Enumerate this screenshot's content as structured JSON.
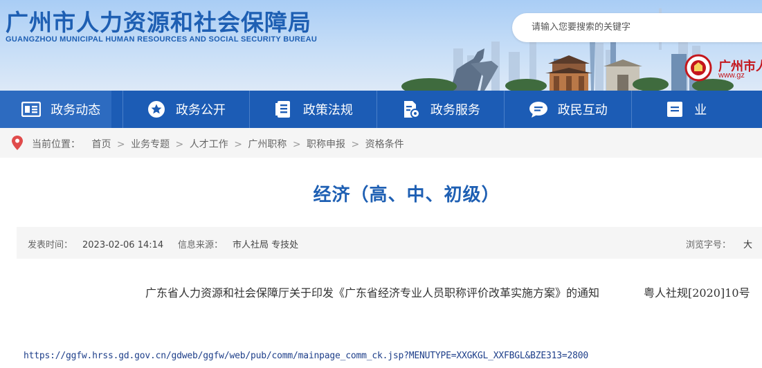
{
  "header": {
    "title": "广州市人力资源和社会保障局",
    "subtitle": "GUANGZHOU MUNICIPAL HUMAN RESOURCES AND SOCIAL SECURITY BUREAU",
    "search_placeholder": "请输入您要搜索的关键字",
    "gov_logo_text": "广州市人",
    "gov_logo_url": "www.gz"
  },
  "nav": {
    "items": [
      {
        "label": "政务动态",
        "icon": "newspaper-icon"
      },
      {
        "label": "政务公开",
        "icon": "star-circle-icon"
      },
      {
        "label": "政策法规",
        "icon": "document-list-icon"
      },
      {
        "label": "政务服务",
        "icon": "document-gear-icon"
      },
      {
        "label": "政民互动",
        "icon": "chat-bubble-icon"
      },
      {
        "label": "业",
        "icon": "list-icon"
      }
    ]
  },
  "breadcrumb": {
    "prefix": "当前位置：",
    "items": [
      "首页",
      "业务专题",
      "人才工作",
      "广州职称",
      "职称申报",
      "资格条件"
    ],
    "separator": ">"
  },
  "article": {
    "title": "经济（高、中、初级）",
    "publish_label": "发表时间：",
    "publish_time": "2023-02-06 14:14",
    "source_label": "信息来源：",
    "source": "市人社局 专技处",
    "font_size_label": "浏览字号：",
    "font_size_option": "大",
    "notice_title": "广东省人力资源和社会保障厅关于印发《广东省经济专业人员职称评价改革实施方案》的通知",
    "notice_doc_no": "粤人社规[2020]10号",
    "url": "https://ggfw.hrss.gd.gov.cn/gdweb/ggfw/web/pub/comm/mainpage_comm_ck.jsp?MENUTYPE=XXGKGL_XXFBGL&BZE313=2800"
  },
  "colors": {
    "brand_blue": "#1c5cb5",
    "title_blue": "#1e5fb3",
    "gov_red": "#c4161c"
  }
}
